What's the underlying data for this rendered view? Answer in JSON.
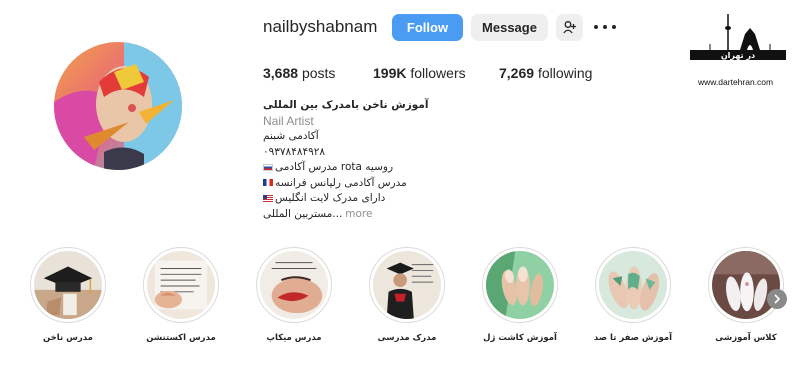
{
  "profile": {
    "username": "nailbyshabnam",
    "follow_label": "Follow",
    "message_label": "Message",
    "add_user_icon": "person-plus-icon",
    "more_icon": "ellipsis-icon"
  },
  "stats": {
    "posts_count": "3,688",
    "posts_label": "posts",
    "followers_count": "199K",
    "followers_label": "followers",
    "following_count": "7,269",
    "following_label": "following"
  },
  "bio": {
    "name": "آموزش ناخن بامدرک بین المللی",
    "category": "Nail Artist",
    "line1": "آکادمی شبنم",
    "line2": "۰۹۳۷۸۴۸۴۹۲۸",
    "line3": "مدرس آکادمی rota روسیه",
    "line4": "مدرس آکادمی رلیانس فرانسه",
    "line5": "دارای مدرک لایت انگلیس",
    "line6": "مستربین المللی...",
    "more_label": "more"
  },
  "watermark": {
    "brand_text": "در تهران",
    "url": "www.dartehran.com"
  },
  "highlights": [
    {
      "label": "مدرس ناخن",
      "icon": "highlight-graduation-cap"
    },
    {
      "label": "مدرس اکستنشن",
      "icon": "highlight-certificate"
    },
    {
      "label": "مدرس میکاپ",
      "icon": "highlight-makeup"
    },
    {
      "label": "مدرک مدرسی",
      "icon": "highlight-diploma"
    },
    {
      "label": "آموزش کاشت ژل",
      "icon": "highlight-gel-nails"
    },
    {
      "label": "آموزش صفر تا صد",
      "icon": "highlight-nail-art"
    },
    {
      "label": "کلاس آموزشی",
      "icon": "highlight-class"
    }
  ],
  "colors": {
    "follow_button": "#4a9cf2",
    "secondary_button": "#efefef",
    "text_primary": "#262626",
    "text_muted": "#8e8e8e"
  }
}
